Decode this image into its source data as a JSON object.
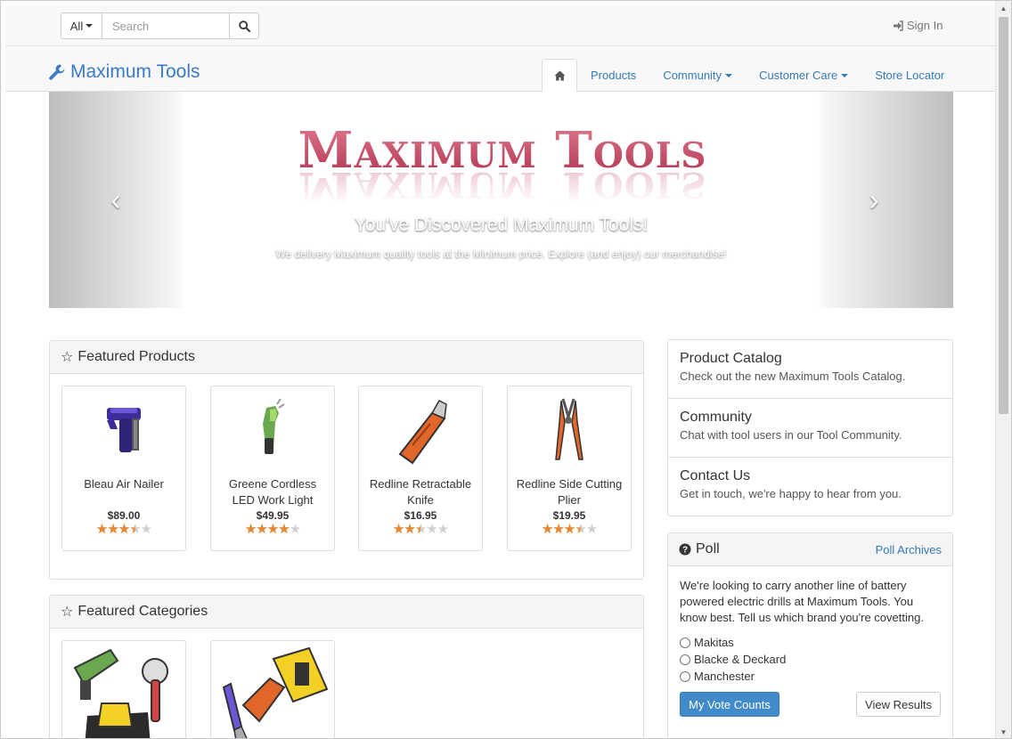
{
  "search": {
    "scope_label": "All",
    "placeholder": "Search",
    "value": ""
  },
  "account": {
    "signin_label": "Sign In"
  },
  "brand": {
    "name": "Maximum Tools"
  },
  "nav": {
    "items": [
      {
        "label": "Products"
      },
      {
        "label": "Community"
      },
      {
        "label": "Customer Care"
      },
      {
        "label": "Store Locator"
      }
    ]
  },
  "carousel": {
    "logo_text": "Maximum Tools",
    "headline": "You've Discovered Maximum Tools!",
    "subline": "We delivery Maximum quality tools at the Minimum price. Explore (and enjoy) our merchandise!"
  },
  "featured_products": {
    "title": "Featured Products",
    "items": [
      {
        "name": "Bleau Air Nailer",
        "price": "$89.00",
        "rating": 3.5
      },
      {
        "name": "Greene Cordless LED Work Light",
        "price": "$49.95",
        "rating": 4
      },
      {
        "name": "Redline Retractable Knife",
        "price": "$16.95",
        "rating": 2.5
      },
      {
        "name": "Redline Side Cutting Plier",
        "price": "$19.95",
        "rating": 3.5
      }
    ]
  },
  "featured_categories": {
    "title": "Featured Categories"
  },
  "info_links": [
    {
      "title": "Product Catalog",
      "desc": "Check out the new Maximum Tools Catalog."
    },
    {
      "title": "Community",
      "desc": "Chat with tool users in our Tool Community."
    },
    {
      "title": "Contact Us",
      "desc": "Get in touch, we're happy to hear from you."
    }
  ],
  "poll": {
    "title": "Poll",
    "archives_label": "Poll Archives",
    "question": "We're looking to carry another line of battery powered electric drills at Maximum Tools. You know best. Tell us which brand you're covetting.",
    "options": [
      {
        "label": "Makitas"
      },
      {
        "label": "Blacke & Deckard"
      },
      {
        "label": "Manchester"
      }
    ],
    "vote_label": "My Vote Counts",
    "results_label": "View Results"
  },
  "colors": {
    "link": "#337ab7",
    "brand": "#3a7bc8",
    "star": "#e8862d",
    "primary_button": "#428bca",
    "logo": "#c8506e"
  }
}
